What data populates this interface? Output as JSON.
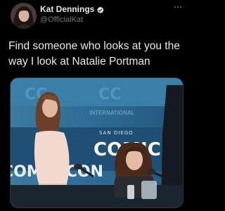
{
  "tweet": {
    "author": {
      "display_name": "Kat Dennings",
      "handle": "@OfficialKat",
      "verified_icon": "verified-badge-icon",
      "avatar_icon": "profile-avatar"
    },
    "more_icon": "more-options-icon",
    "text": "Find someone who looks at you the way I look at Natalie Portman",
    "media": {
      "photo_icon": "attached-photo",
      "banner_text": "COMIC-CON",
      "banner_subtext": "SAN DIEGO",
      "banner_partial_text": "INTERNATIONAL"
    }
  },
  "colors": {
    "background": "#000000",
    "text_primary": "#e7e9ea",
    "text_secondary": "#71767b",
    "verified": "#1d9bf0"
  }
}
